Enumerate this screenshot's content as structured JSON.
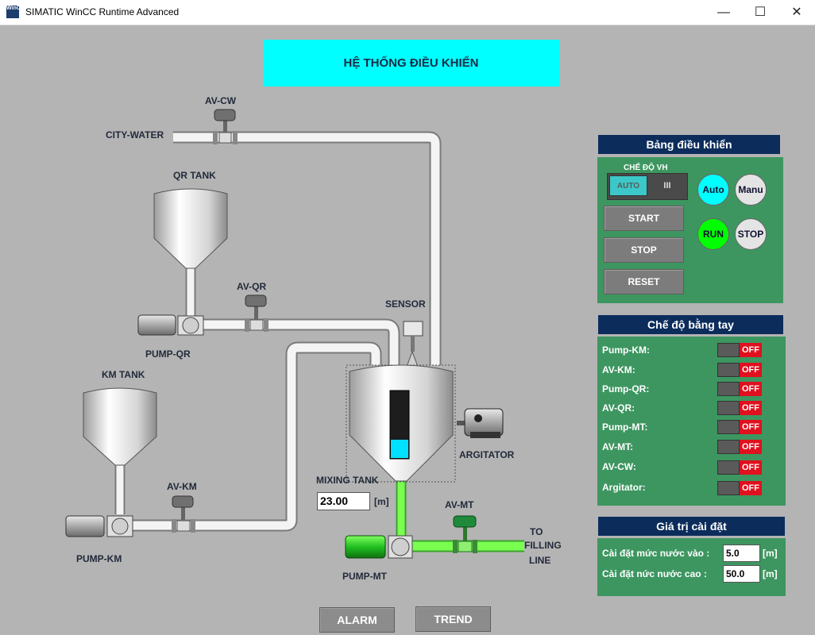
{
  "window": {
    "title": "SIMATIC WinCC Runtime Advanced",
    "icon_text": "WinCC",
    "minimize_icon": "—",
    "maximize_icon": "☐",
    "close_icon": "✕"
  },
  "header": {
    "title": "HỆ THỐNG ĐIỀU KHIỂN"
  },
  "process": {
    "city_water": "CITY-WATER",
    "av_cw": "AV-CW",
    "qr_tank": "QR TANK",
    "av_qr": "AV-QR",
    "pump_qr": "PUMP-QR",
    "km_tank": "KM TANK",
    "av_km": "AV-KM",
    "pump_km": "PUMP-KM",
    "sensor": "SENSOR",
    "argitator": "ARGITATOR",
    "mixing_tank": "MIXING TANK",
    "level_value": "23.00",
    "level_unit": "[m]",
    "level_fill_fraction": 0.27,
    "av_mt": "AV-MT",
    "pump_mt": "PUMP-MT",
    "to_filling_line": [
      "TO",
      "FILLING",
      "LINE"
    ]
  },
  "control_panel": {
    "title": "Bảng điều khiển",
    "mode_label": "CHẾ ĐỘ VH",
    "mode_switch": {
      "left": "AUTO",
      "right": "III"
    },
    "buttons": {
      "start": "START",
      "stop": "STOP",
      "reset": "RESET"
    },
    "indicators": {
      "auto": "Auto",
      "manu": "Manu",
      "run": "RUN",
      "stop": "STOP"
    }
  },
  "manual_panel": {
    "title": "Chế độ bằng tay",
    "rows": [
      {
        "label": "Pump-KM:",
        "state": "OFF"
      },
      {
        "label": "AV-KM:",
        "state": "OFF"
      },
      {
        "label": "Pump-QR:",
        "state": "OFF"
      },
      {
        "label": "AV-QR:",
        "state": "OFF"
      },
      {
        "label": "Pump-MT:",
        "state": "OFF"
      },
      {
        "label": "AV-MT:",
        "state": "OFF"
      },
      {
        "label": "AV-CW:",
        "state": "OFF"
      },
      {
        "label": "Argitator:",
        "state": "OFF"
      }
    ]
  },
  "setpoints": {
    "title": "Giá trị cài đặt",
    "inlet_label": "Cài đặt mức nước vào :",
    "inlet_value": "5.0",
    "high_label": "Cài đặt nức nước cao :",
    "high_value": "50.0",
    "unit": "[m]"
  },
  "footer": {
    "alarm": "ALARM",
    "trend": "TREND"
  },
  "colors": {
    "accent": "#00ffff",
    "panel_green": "#3d9660",
    "panel_title": "#0c2d5c",
    "off_red": "#e0101e",
    "run_green": "#00ff00",
    "auto_cyan": "#00ffff",
    "active_pipe": "#66ff44"
  }
}
